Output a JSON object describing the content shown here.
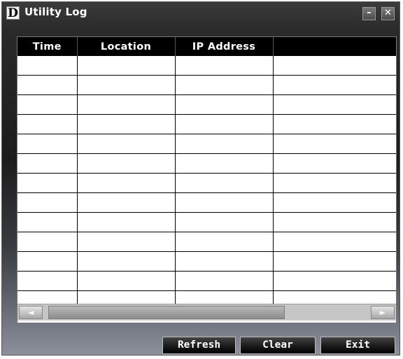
{
  "window": {
    "title": "Utility Log",
    "logo_letter": "D",
    "minimize_glyph": "–",
    "close_glyph": "✕"
  },
  "table": {
    "columns": [
      "Time",
      "Location",
      "IP Address",
      ""
    ],
    "rows": [
      [
        "",
        "",
        "",
        ""
      ],
      [
        "",
        "",
        "",
        ""
      ],
      [
        "",
        "",
        "",
        ""
      ],
      [
        "",
        "",
        "",
        ""
      ],
      [
        "",
        "",
        "",
        ""
      ],
      [
        "",
        "",
        "",
        ""
      ],
      [
        "",
        "",
        "",
        ""
      ],
      [
        "",
        "",
        "",
        ""
      ],
      [
        "",
        "",
        "",
        ""
      ],
      [
        "",
        "",
        "",
        ""
      ],
      [
        "",
        "",
        "",
        ""
      ],
      [
        "",
        "",
        "",
        ""
      ],
      [
        "",
        "",
        "",
        ""
      ]
    ]
  },
  "scrollbar": {
    "left_glyph": "◄",
    "right_glyph": "►"
  },
  "buttons": {
    "refresh": "Refresh",
    "clear": "Clear",
    "exit": "Exit"
  }
}
